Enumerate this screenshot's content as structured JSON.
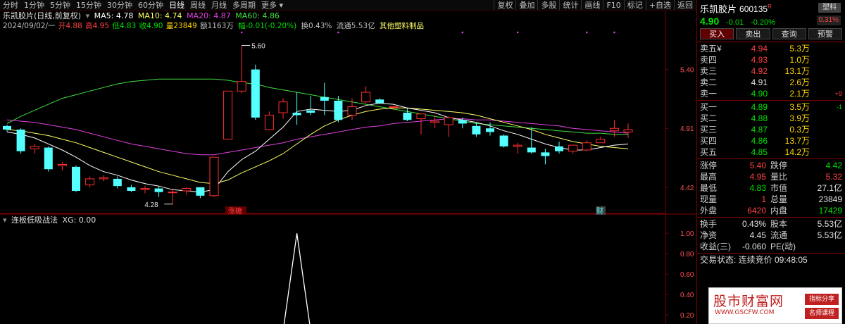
{
  "toolbar": {
    "periods": [
      "分时",
      "1分钟",
      "5分钟",
      "15分钟",
      "30分钟",
      "60分钟",
      "日线",
      "周线",
      "月线",
      "多周期",
      "更多"
    ],
    "active_period": "日线",
    "tools": [
      "复权",
      "叠加",
      "多股",
      "统计",
      "画线",
      "F10",
      "标记",
      "+自选",
      "返回"
    ]
  },
  "chart_header": {
    "title": "乐凯胶片(日线,前复权)",
    "ma5": "MA5: 4.78",
    "ma10": "MA10: 4.74",
    "ma20": "MA20: 4.87",
    "ma60": "MA60: 4.86",
    "date": "2024/09/02/一",
    "open": "开4.88",
    "high": "高4.95",
    "low": "低4.83",
    "close": "收4.90",
    "volume": "量23849",
    "amount": "额1163万",
    "change": "幅-0.01(-0.20%)",
    "turnover": "换0.43%",
    "float_cap": "流通5.53亿",
    "sector": "其他塑料制品"
  },
  "indicator": {
    "title": "连板低吸战法",
    "xg": "XG: 0.00"
  },
  "markers": {
    "event_left": "涨糖",
    "event_right": "财"
  },
  "colors": {
    "up": "#ff3030",
    "down": "#54ffff",
    "ma5": "#ffffff",
    "ma10": "#ffff66",
    "ma20": "#e040e0",
    "ma60": "#40e040",
    "border": "#800000"
  },
  "chart_data": {
    "type": "candlestick",
    "price_axis_ticks": [
      "5.40",
      "4.91",
      "4.42"
    ],
    "indicator_axis_ticks": [
      "1.00",
      "0.80",
      "0.60",
      "0.40",
      "0.20"
    ],
    "max_label": "5.60",
    "min_label": "4.28",
    "ohlc": [
      [
        4.93,
        4.94,
        4.88,
        4.9
      ],
      [
        4.9,
        4.91,
        4.7,
        4.72
      ],
      [
        4.74,
        4.78,
        4.7,
        4.76
      ],
      [
        4.75,
        4.76,
        4.55,
        4.57
      ],
      [
        4.6,
        4.63,
        4.56,
        4.61
      ],
      [
        4.59,
        4.6,
        4.38,
        4.39
      ],
      [
        4.44,
        4.51,
        4.42,
        4.49
      ],
      [
        4.49,
        4.52,
        4.47,
        4.5
      ],
      [
        4.49,
        4.51,
        4.41,
        4.43
      ],
      [
        4.42,
        4.44,
        4.38,
        4.39
      ],
      [
        4.4,
        4.43,
        4.37,
        4.41
      ],
      [
        4.41,
        4.43,
        4.34,
        4.38
      ],
      [
        4.38,
        4.41,
        4.28,
        4.38
      ],
      [
        4.39,
        4.42,
        4.36,
        4.41
      ],
      [
        4.42,
        4.42,
        4.33,
        4.35
      ],
      [
        4.35,
        4.67,
        4.34,
        4.67
      ],
      [
        4.82,
        5.22,
        4.82,
        5.22
      ],
      [
        5.22,
        5.6,
        5.2,
        5.3
      ],
      [
        5.4,
        5.44,
        4.98,
        5.0
      ],
      [
        4.9,
        5.05,
        4.9,
        5.02
      ],
      [
        5.04,
        5.16,
        4.99,
        5.13
      ],
      [
        5.04,
        5.21,
        4.94,
        5.02
      ],
      [
        5.06,
        5.18,
        5.02,
        5.04
      ],
      [
        5.17,
        5.29,
        5.02,
        5.14
      ],
      [
        5.14,
        5.18,
        4.96,
        4.98
      ],
      [
        5.02,
        5.16,
        4.98,
        5.09
      ],
      [
        5.13,
        5.26,
        5.12,
        5.21
      ],
      [
        5.15,
        5.16,
        5.11,
        5.12
      ],
      [
        5.09,
        5.1,
        5.06,
        5.09
      ],
      [
        5.04,
        5.08,
        4.97,
        4.98
      ],
      [
        4.99,
        5.02,
        4.86,
        5.03
      ],
      [
        4.96,
        5.02,
        4.91,
        4.97
      ],
      [
        4.94,
        5.01,
        4.84,
        5.0
      ],
      [
        4.98,
        5.0,
        4.91,
        4.95
      ],
      [
        4.93,
        4.96,
        4.84,
        4.86
      ],
      [
        4.91,
        4.96,
        4.85,
        4.88
      ],
      [
        4.85,
        4.86,
        4.75,
        4.76
      ],
      [
        4.76,
        4.79,
        4.7,
        4.77
      ],
      [
        4.75,
        4.92,
        4.7,
        4.71
      ],
      [
        4.71,
        4.74,
        4.61,
        4.68
      ],
      [
        4.76,
        4.8,
        4.7,
        4.72
      ],
      [
        4.72,
        4.77,
        4.7,
        4.77
      ],
      [
        4.73,
        4.81,
        4.72,
        4.79
      ],
      [
        4.79,
        4.84,
        4.79,
        4.82
      ],
      [
        4.89,
        4.98,
        4.84,
        4.91
      ],
      [
        4.88,
        4.95,
        4.83,
        4.9
      ]
    ],
    "ma5": [
      4.88,
      4.86,
      4.83,
      4.78,
      4.73,
      4.67,
      4.6,
      4.55,
      4.52,
      4.48,
      4.45,
      4.43,
      4.4,
      4.39,
      4.38,
      4.4,
      4.55,
      4.65,
      4.72,
      4.82,
      4.92,
      5.05,
      5.07,
      5.06,
      5.05,
      5.06,
      5.1,
      5.12,
      5.11,
      5.08,
      5.06,
      5.04,
      5.0,
      4.98,
      4.96,
      4.93,
      4.89,
      4.86,
      4.82,
      4.78,
      4.75,
      4.73,
      4.73,
      4.75,
      4.77,
      4.78
    ],
    "ma10": [
      4.9,
      4.89,
      4.87,
      4.85,
      4.82,
      4.79,
      4.75,
      4.71,
      4.67,
      4.63,
      4.59,
      4.55,
      4.52,
      4.49,
      4.46,
      4.45,
      4.48,
      4.54,
      4.59,
      4.64,
      4.7,
      4.78,
      4.86,
      4.93,
      4.98,
      5.02,
      5.05,
      5.07,
      5.08,
      5.08,
      5.07,
      5.06,
      5.05,
      5.04,
      5.02,
      4.99,
      4.96,
      4.93,
      4.9,
      4.86,
      4.83,
      4.8,
      4.78,
      4.76,
      4.75,
      4.74
    ],
    "ma20": [
      4.98,
      4.97,
      4.96,
      4.94,
      4.92,
      4.9,
      4.87,
      4.84,
      4.81,
      4.78,
      4.76,
      4.74,
      4.72,
      4.7,
      4.69,
      4.69,
      4.71,
      4.73,
      4.75,
      4.77,
      4.79,
      4.82,
      4.84,
      4.86,
      4.88,
      4.9,
      4.92,
      4.93,
      4.95,
      4.96,
      4.97,
      4.98,
      4.99,
      4.99,
      4.98,
      4.98,
      4.97,
      4.96,
      4.95,
      4.94,
      4.93,
      4.91,
      4.9,
      4.89,
      4.88,
      4.87
    ],
    "ma60": [
      4.95,
      5.01,
      5.06,
      5.11,
      5.16,
      5.19,
      5.22,
      5.25,
      5.28,
      5.3,
      5.31,
      5.32,
      5.32,
      5.32,
      5.32,
      5.32,
      5.31,
      5.29,
      5.28,
      5.25,
      5.23,
      5.21,
      5.19,
      5.17,
      5.15,
      5.13,
      5.11,
      5.09,
      5.07,
      5.05,
      5.03,
      5.01,
      4.99,
      4.97,
      4.95,
      4.94,
      4.93,
      4.92,
      4.91,
      4.9,
      4.89,
      4.88,
      4.87,
      4.87,
      4.86,
      4.86
    ],
    "xg": [
      0,
      0,
      0,
      0,
      0,
      0,
      0,
      0,
      0,
      0,
      0,
      0,
      0,
      0,
      0,
      0,
      0,
      0,
      0,
      0,
      0,
      1,
      0,
      0,
      0,
      0,
      0,
      0,
      0,
      0,
      0,
      0,
      0,
      0,
      0,
      0,
      0,
      0,
      0,
      0,
      0,
      0,
      0,
      0,
      0,
      0
    ]
  },
  "quote": {
    "name": "乐凯胶片",
    "code": "600135",
    "code_suffix": "R",
    "tag": "塑料",
    "price": "4.90",
    "change": "-0.01",
    "change_pct": "-0.20%",
    "pct_badge": "0.31%",
    "buttons": [
      "买入",
      "卖出",
      "查询",
      "预警"
    ],
    "asks": [
      {
        "label": "卖五",
        "mark": "¥",
        "price": "4.94",
        "vol": "5.3万",
        "delta": ""
      },
      {
        "label": "卖四",
        "mark": "",
        "price": "4.93",
        "vol": "1.0万",
        "delta": ""
      },
      {
        "label": "卖三",
        "mark": "",
        "price": "4.92",
        "vol": "13.1万",
        "delta": ""
      },
      {
        "label": "卖二",
        "mark": "",
        "price": "4.91",
        "vol": "2.6万",
        "delta": ""
      },
      {
        "label": "卖一",
        "mark": "",
        "price": "4.90",
        "vol": "2.1万",
        "delta": "+9"
      }
    ],
    "bids": [
      {
        "label": "买一",
        "price": "4.89",
        "vol": "3.5万",
        "delta": "-1"
      },
      {
        "label": "买二",
        "price": "4.88",
        "vol": "3.9万",
        "delta": ""
      },
      {
        "label": "买三",
        "price": "4.87",
        "vol": "0.3万",
        "delta": ""
      },
      {
        "label": "买四",
        "price": "4.86",
        "vol": "13.7万",
        "delta": ""
      },
      {
        "label": "买五",
        "price": "4.85",
        "vol": "14.2万",
        "delta": ""
      }
    ],
    "stats": [
      {
        "l1": "涨停",
        "v1": "5.40",
        "c1": "#ff4040",
        "l2": "跌停",
        "v2": "4.42",
        "c2": "#00e000"
      },
      {
        "l1": "最高",
        "v1": "4.95",
        "c1": "#ff4040",
        "l2": "量比",
        "v2": "5.32",
        "c2": "#ff4040"
      },
      {
        "l1": "最低",
        "v1": "4.83",
        "c1": "#00e000",
        "l2": "市值",
        "v2": "27.1亿",
        "c2": "#e0e0e0"
      },
      {
        "l1": "现量",
        "v1": "1",
        "c1": "#ff4040",
        "l2": "总量",
        "v2": "23849",
        "c2": "#e0e0e0"
      },
      {
        "l1": "外盘",
        "v1": "6420",
        "c1": "#ff4040",
        "l2": "内盘",
        "v2": "17429",
        "c2": "#00e000"
      }
    ],
    "stats2": [
      {
        "l1": "换手",
        "v1": "0.43%",
        "c1": "#e0e0e0",
        "l2": "股本",
        "v2": "5.53亿",
        "c2": "#e0e0e0"
      },
      {
        "l1": "净资",
        "v1": "4.45",
        "c1": "#e0e0e0",
        "l2": "流通",
        "v2": "5.53亿",
        "c2": "#e0e0e0"
      },
      {
        "l1": "收益(三)",
        "v1": "-0.060",
        "c1": "#e0e0e0",
        "l2": "PE(动)",
        "v2": "",
        "c2": "#e0e0e0"
      }
    ],
    "trade_status": "交易状态: 连续竞价 09:48:05"
  },
  "watermark": {
    "main": "股市财富网",
    "url": "WWW.GSCFW.COM",
    "badge1": "指标分享",
    "badge2": "名师课程"
  }
}
